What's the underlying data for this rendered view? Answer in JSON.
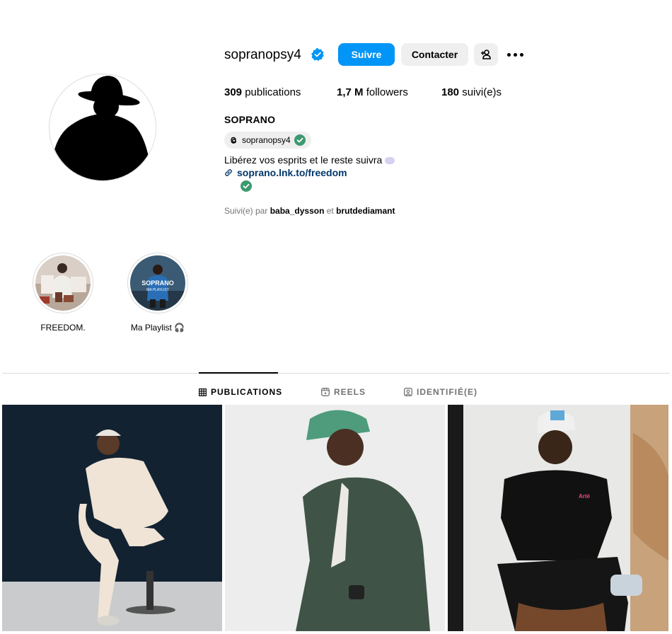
{
  "profile": {
    "username": "sopranopsy4",
    "follow_label": "Suivre",
    "contact_label": "Contacter",
    "stats": {
      "posts_count": "309",
      "posts_label": "publications",
      "followers_count": "1,7 M",
      "followers_label": "followers",
      "following_count": "180",
      "following_label": "suivi(e)s"
    },
    "full_name": "SOPRANO",
    "threads_handle": "sopranopsy4",
    "bio": "Libérez vos esprits et le reste suivra",
    "link": "soprano.lnk.to/freedom",
    "followed_by_prefix": "Suivi(e) par",
    "followed_by_user1": "baba_dysson",
    "followed_by_and": "et",
    "followed_by_user2": "brutdediamant"
  },
  "highlights": [
    {
      "label": "FREEDOM."
    },
    {
      "label": "Ma Playlist 🎧",
      "cover_text_1": "SOPRANO",
      "cover_text_2": "MA PLAYLIST"
    }
  ],
  "tabs": [
    {
      "label": "PUBLICATIONS",
      "icon": "grid-icon",
      "active": true
    },
    {
      "label": "REELS",
      "icon": "reels-icon",
      "active": false
    },
    {
      "label": "IDENTIFIÉ(E)",
      "icon": "tagged-icon",
      "active": false
    }
  ],
  "post_3_shirt_text": "Arté",
  "colors": {
    "accent": "#0095f6",
    "verified": "#0095f6",
    "link": "#00376b",
    "check_green": "#3d9970"
  }
}
